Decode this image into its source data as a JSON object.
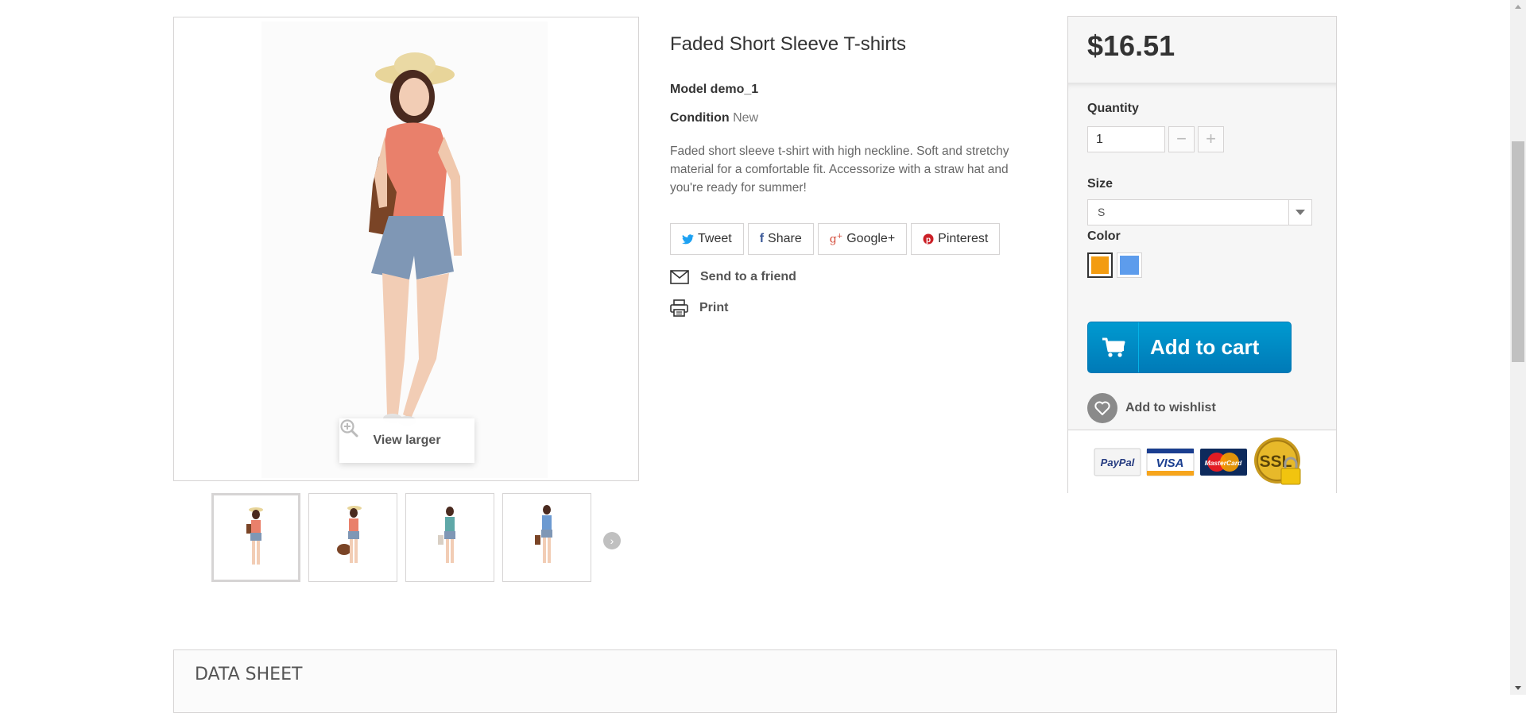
{
  "product": {
    "title": "Faded Short Sleeve T-shirts",
    "model_label": "Model",
    "model_value": "demo_1",
    "condition_label": "Condition",
    "condition_value": "New",
    "description": "Faded short sleeve t-shirt with high neckline. Soft and stretchy material for a comfortable fit. Accessorize with a straw hat and you're ready for summer!",
    "view_larger": "View larger",
    "thumbnails": [
      "orange-shirt-front",
      "orange-shirt-bag",
      "blue-shirt-bag",
      "blue-shirt-back"
    ]
  },
  "social": {
    "tweet": "Tweet",
    "share": "Share",
    "google": "Google+",
    "pinterest": "Pinterest",
    "twitter_color": "#1da1f2",
    "facebook_color": "#3b5998",
    "google_color": "#d34836",
    "pinterest_color": "#cb2027"
  },
  "actions": {
    "send_friend": "Send to a friend",
    "print": "Print"
  },
  "buybox": {
    "price": "$16.51",
    "quantity_label": "Quantity",
    "quantity_value": "1",
    "minus": "−",
    "plus": "+",
    "size_label": "Size",
    "size_value": "S",
    "color_label": "Color",
    "colors": [
      "#f39c11",
      "#5d9cec"
    ],
    "add_to_cart": "Add to cart",
    "add_to_wishlist": "Add to wishlist",
    "accent_color": "#009ad0"
  },
  "payment": {
    "paypal": "PayPal",
    "visa": "VISA",
    "mastercard": "MasterCard",
    "ssl": "SSL"
  },
  "datasheet": {
    "title": "DATA SHEET"
  }
}
